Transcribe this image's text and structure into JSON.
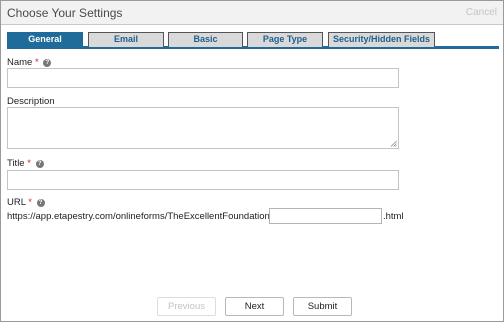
{
  "dialog": {
    "title": "Choose Your Settings",
    "cancel_label": "Cancel"
  },
  "tabs": [
    {
      "label": "General",
      "active": true
    },
    {
      "label": "Email",
      "active": false
    },
    {
      "label": "Basic",
      "active": false
    },
    {
      "label": "Page Type",
      "active": false
    },
    {
      "label": "Security/Hidden Fields",
      "active": false
    }
  ],
  "form": {
    "name": {
      "label": "Name",
      "required_mark": "*",
      "value": ""
    },
    "description": {
      "label": "Description",
      "value": ""
    },
    "title": {
      "label": "Title",
      "required_mark": "*",
      "value": ""
    },
    "url": {
      "label": "URL",
      "required_mark": "*",
      "prefix": "https://app.etapestry.com/onlineforms/TheExcellentFoundation/",
      "value": "",
      "suffix": ".html"
    }
  },
  "buttons": {
    "previous": "Previous",
    "next": "Next",
    "submit": "Submit"
  },
  "colors": {
    "accent": "#1f6b99",
    "required": "#d42a2a",
    "inactive_tab": "#d9d9d9"
  },
  "icons": {
    "help": "question-circle-icon",
    "resize": "resize-grip-icon"
  }
}
